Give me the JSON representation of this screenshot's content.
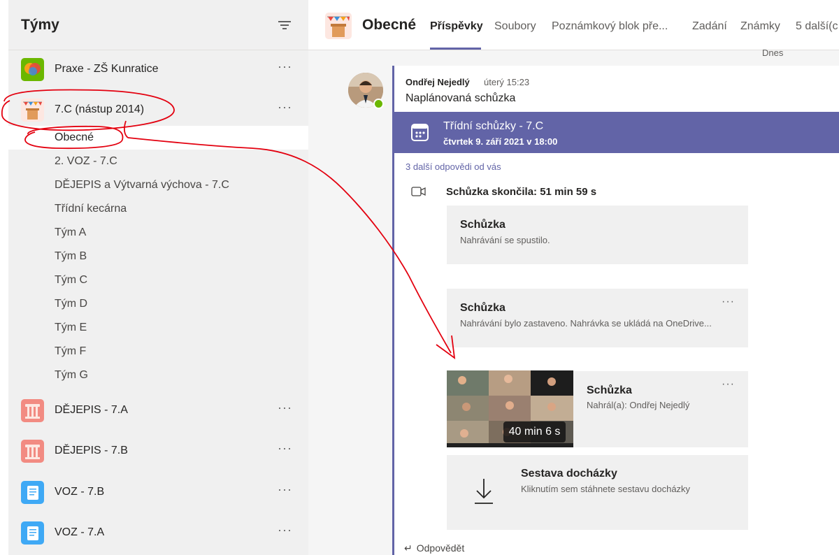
{
  "left_pane": {
    "title": "Týmy",
    "teams": [
      {
        "name": "Praxe - ZŠ Kunratice",
        "more": "···"
      },
      {
        "name": "7.C (nástup 2014)",
        "more": "···"
      },
      {
        "name": "DĚJEPIS - 7.A",
        "more": "···"
      },
      {
        "name": "DĚJEPIS - 7.B",
        "more": "···"
      },
      {
        "name": "VOZ - 7.B",
        "more": "···"
      },
      {
        "name": "VOZ - 7.A",
        "more": "···"
      }
    ],
    "channels": [
      "Obecné",
      "2. VOZ - 7.C",
      "DĚJEPIS a Výtvarná výchova - 7.C",
      "Třídní kecárna",
      "Tým A",
      "Tým B",
      "Tým C",
      "Tým D",
      "Tým E",
      "Tým F",
      "Tým G"
    ]
  },
  "topbar": {
    "channel_name": "Obecné",
    "tabs": [
      "Příspěvky",
      "Soubory",
      "Poznámkový blok pře...",
      "Zadání",
      "Známky",
      "5 další(c"
    ]
  },
  "feed": {
    "date_divider": "Dnes",
    "post": {
      "author": "Ondřej Nejedlý",
      "time": "úterý 15:23",
      "text": "Naplánovaná schůzka"
    },
    "meeting": {
      "title": "Třídní schůzky - 7.C",
      "date": "čtvrtek 9. září 2021 v 18:00"
    },
    "more_replies": "3 další odpovědi od vás",
    "ended": "Schůzka skončila: 51 min 59 s",
    "cards": [
      {
        "title": "Schůzka",
        "desc": "Nahrávání se spustilo."
      },
      {
        "title": "Schůzka",
        "desc": "Nahrávání bylo zastaveno. Nahrávka se ukládá na OneDrive...",
        "more": "···"
      },
      {
        "title": "Schůzka",
        "desc": "Nahrál(a): Ondřej Nejedlý",
        "more": "···",
        "duration": "40 min 6 s"
      },
      {
        "title": "Sestava docházky",
        "desc": "Kliknutím sem stáhnete sestavu docházky"
      }
    ],
    "reply": "Odpovědět"
  },
  "colors": {
    "accent": "#6264a7",
    "annotation_red": "#e3000f",
    "presence_green": "#6bb700"
  }
}
